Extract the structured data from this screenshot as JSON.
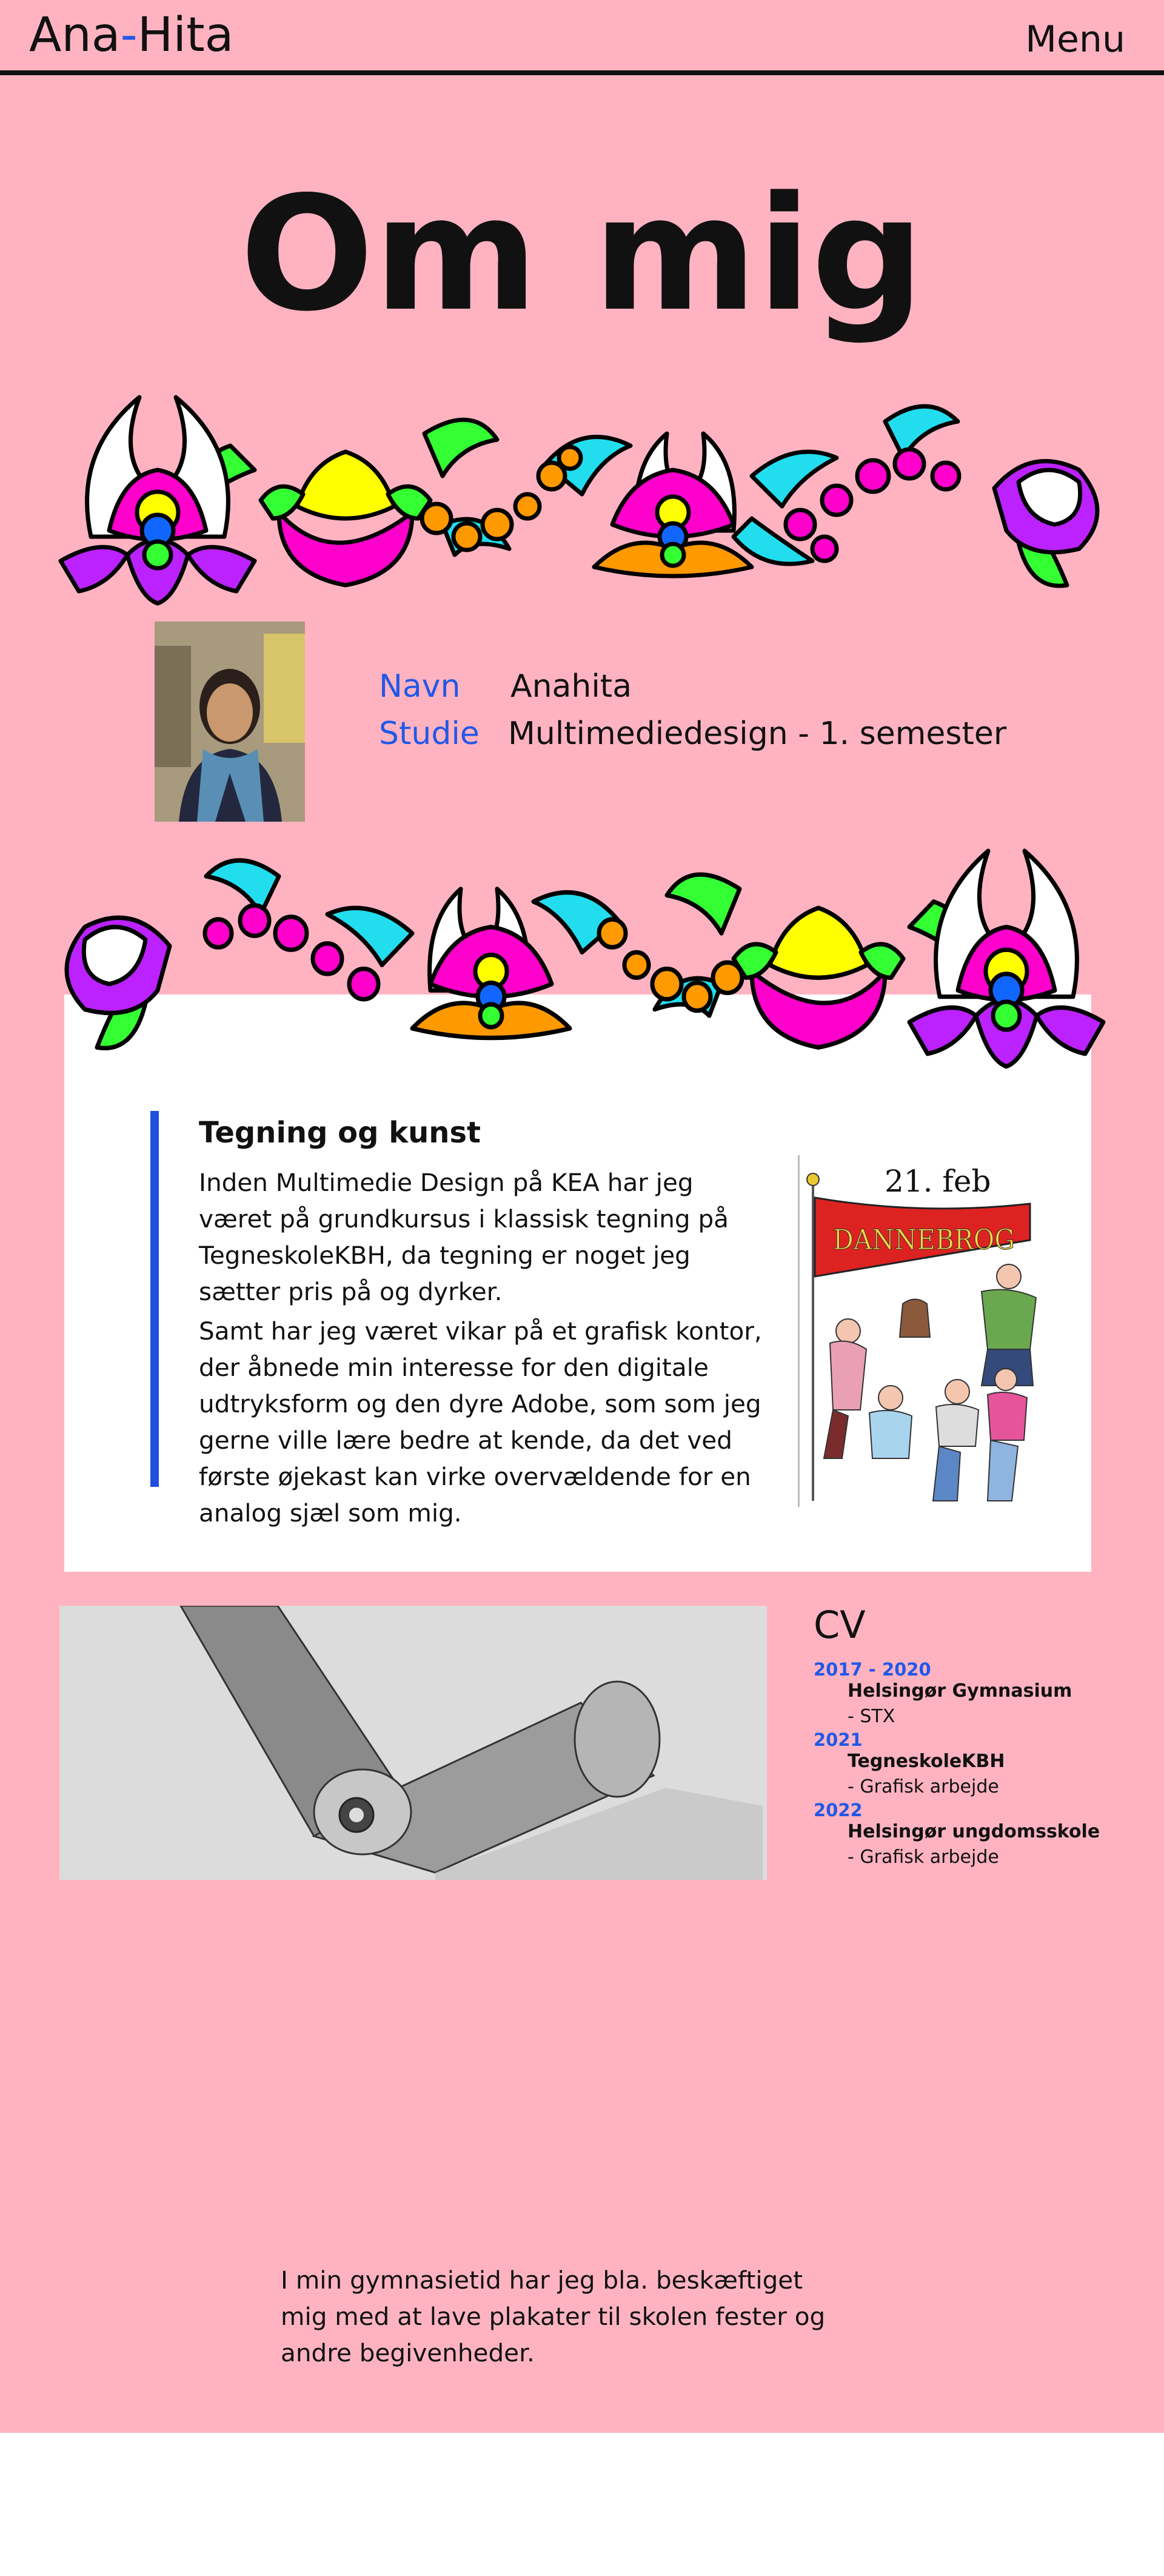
{
  "header": {
    "logo_part1": "Ana",
    "logo_dash": "-",
    "logo_part2": "Hita",
    "menu_label": "Menu"
  },
  "page_title": "Om mig",
  "profile": {
    "name_label": "Navn",
    "name_value": "Anahita",
    "study_label": "Studie",
    "study_value": "Multimediedesign - 1. semester"
  },
  "art": {
    "title": "Tegning og kunst",
    "paragraph1": "Inden Multimedie Design på KEA har jeg været på grundkursus i klassisk tegning på TegneskoleKBH, da tegning er noget jeg sætter pris på og dyrker.",
    "paragraph2": "Samt har jeg været vikar på et grafisk kontor, der åbnede min interesse for den digitale udtryksform og den dyre Adobe, som som jeg gerne ville lære bedre at kende, da det ved første øjekast kan virke overvældende for en analog sjæl som mig."
  },
  "poster": {
    "date_text": "21. feb",
    "banner_text": "DANNEBROG"
  },
  "cv": {
    "title": "CV",
    "entries": [
      {
        "years": "2017 - 2020",
        "place": "Helsingør Gymnasium",
        "role": "- STX"
      },
      {
        "years": "2021",
        "place": "TegneskoleKBH",
        "role": "- Grafisk arbejde"
      },
      {
        "years": "2022",
        "place": "Helsingør ungdomsskole",
        "role": "- Grafisk arbejde"
      }
    ]
  },
  "bottom_text": "I min gymnasietid har jeg bla. beskæftiget mig med at lave plakater til skolen fester og andre begivenheder.",
  "colors": {
    "background": "#ffb3c1",
    "accent_blue": "#2158e8",
    "flower_magenta": "#ff00cc",
    "flower_yellow": "#ffff00",
    "flower_green": "#33ff33",
    "flower_cyan": "#22ddee",
    "flower_orange": "#ff9900",
    "flower_purple": "#bb22ff"
  }
}
